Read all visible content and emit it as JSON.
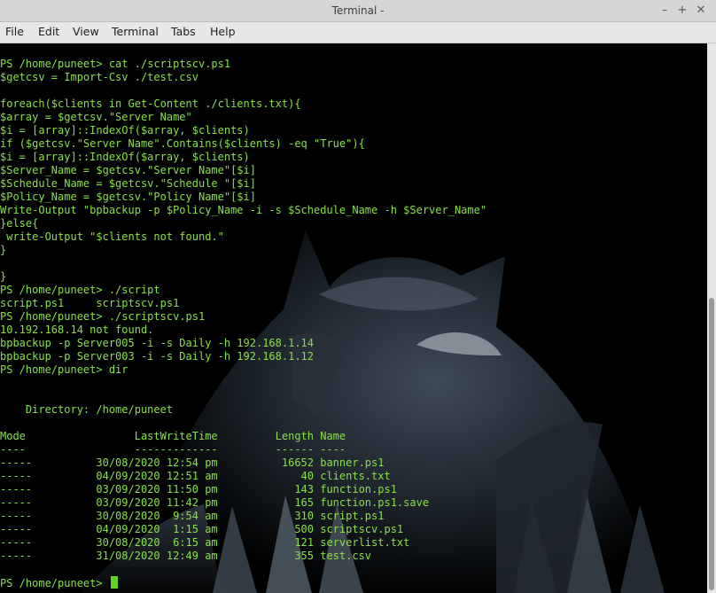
{
  "window": {
    "title": "Terminal -",
    "controls": {
      "minimize": "–",
      "maximize": "+",
      "close": "✕"
    }
  },
  "menu": [
    "File",
    "Edit",
    "View",
    "Terminal",
    "Tabs",
    "Help"
  ],
  "terminal": {
    "text_color": "#8ae04a",
    "background": "#000000",
    "lines": [
      [
        "PS /home/puneet> ",
        "cat",
        " ./scriptscv.ps1"
      ],
      [
        "$getcsv = Import-Csv ./test.csv"
      ],
      [
        ""
      ],
      [
        "foreach($clients in Get-Content ./clients.txt){"
      ],
      [
        "$array = $getcsv.\"Server Name\""
      ],
      [
        "$i = [array]::IndexOf($array, $clients)"
      ],
      [
        "if ($getcsv.\"Server Name\".Contains($clients) -eq \"True\"){"
      ],
      [
        "$i = [array]::IndexOf($array, $clients)"
      ],
      [
        "$Server_Name = $getcsv.\"Server Name\"[$i]"
      ],
      [
        "$Schedule_Name = $getcsv.\"Schedule \"[$i]"
      ],
      [
        "$Policy_Name = $getcsv.\"Policy Name\"[$i]"
      ],
      [
        "Write-Output \"bpbackup -p $Policy_Name -i -s $Schedule_Name -h $Server_Name\""
      ],
      [
        "}else{"
      ],
      [
        " write-Output \"$clients not found.\""
      ],
      [
        "}"
      ],
      [
        ""
      ],
      [
        "}"
      ],
      [
        "PS /home/puneet> ",
        "./script"
      ],
      [
        "script.ps1     scriptscv.ps1"
      ],
      [
        "PS /home/puneet> ",
        "./scriptscv.ps1"
      ],
      [
        "10.192.168.14 not found."
      ],
      [
        "bpbackup -p Server005 -i -s Daily -h 192.168.1.14"
      ],
      [
        "bpbackup -p Server003 -i -s Daily -h 192.168.1.12"
      ],
      [
        "PS /home/puneet> ",
        "dir"
      ],
      [
        ""
      ],
      [
        ""
      ],
      [
        "    Directory: /home/puneet"
      ],
      [
        ""
      ],
      [
        "Mode                 LastWriteTime         Length Name"
      ],
      [
        "----                 -------------         ------ ----"
      ],
      [
        "-----          30/08/2020 12:54 pm          16652 banner.ps1"
      ],
      [
        "-----          04/09/2020 12:51 am             40 clients.txt"
      ],
      [
        "-----          03/09/2020 11:50 pm            143 function.ps1"
      ],
      [
        "-----          03/09/2020 11:42 pm            165 function.ps1.save"
      ],
      [
        "-----          30/08/2020  9:54 am            310 script.ps1"
      ],
      [
        "-----          04/09/2020  1:15 am            500 scriptscv.ps1"
      ],
      [
        "-----          30/08/2020  6:15 am            121 serverlist.txt"
      ],
      [
        "-----          31/08/2020 12:49 am            355 test.csv"
      ],
      [
        ""
      ],
      [
        "PS /home/puneet> "
      ]
    ]
  }
}
